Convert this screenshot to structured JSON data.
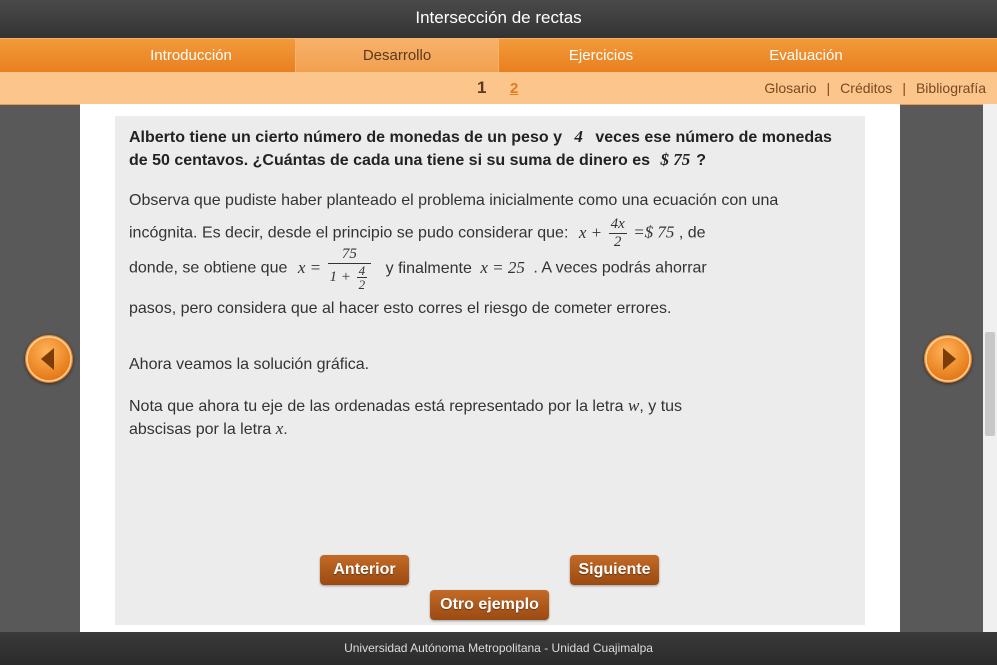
{
  "window": {
    "title": "Intersección de rectas"
  },
  "nav": {
    "tabs": [
      {
        "label": "Introducción",
        "active": false
      },
      {
        "label": "Desarrollo",
        "active": true
      },
      {
        "label": "Ejercicios",
        "active": false
      },
      {
        "label": "Evaluación",
        "active": false
      }
    ]
  },
  "subnav": {
    "pages": [
      "1",
      "2"
    ],
    "current_page": "1",
    "links": [
      "Glosario",
      "Créditos",
      "Bibliografía"
    ],
    "separator": "|"
  },
  "content": {
    "question": {
      "part1": "Alberto tiene un cierto número de monedas de un peso y",
      "num4": "4",
      "part2": "veces ese número de monedas de 50 centavos. ¿Cuántas de cada una tiene si su suma de dinero es",
      "amount": "$ 75",
      "part3": "?"
    },
    "para1": {
      "a": "Observa que pudiste haber planteado el problema inicialmente como una ecuación con una incógnita. Es decir, desde el principio se pudo considerar que:",
      "eq_x_plus": "x +",
      "eq_num": "4x",
      "eq_den": "2",
      "eq_rhs": "=$ 75",
      "b": ", de"
    },
    "para2": {
      "a": "donde, se obtiene que",
      "x_eq": "x =",
      "f_num": "75",
      "f_den_a": "1 +",
      "f_den_num": "4",
      "f_den_den": "2",
      "b": "y finalmente",
      "x25": "x = 25",
      "c": ". A veces podrás ahorrar"
    },
    "para3": "pasos, pero considera que al hacer esto corres el riesgo de cometer errores.",
    "para4": "Ahora veamos la solución gráfica.",
    "para5": {
      "a": "Nota que ahora tu eje de las ordenadas está representado por la letra",
      "w": "w",
      "b": ", y tus",
      "c": "abscisas por la letra",
      "x": "x",
      "d": "."
    },
    "buttons": {
      "prev": "Anterior",
      "next": "Siguiente",
      "other": "Otro ejemplo"
    }
  },
  "footer": {
    "text": "Universidad Autónoma Metropolitana - Unidad Cuajimalpa"
  },
  "icons": {
    "left_arrow": "chevron-left-icon",
    "right_arrow": "chevron-right-icon"
  },
  "colors": {
    "accent": "#e9801f",
    "button": "#b0561a"
  }
}
